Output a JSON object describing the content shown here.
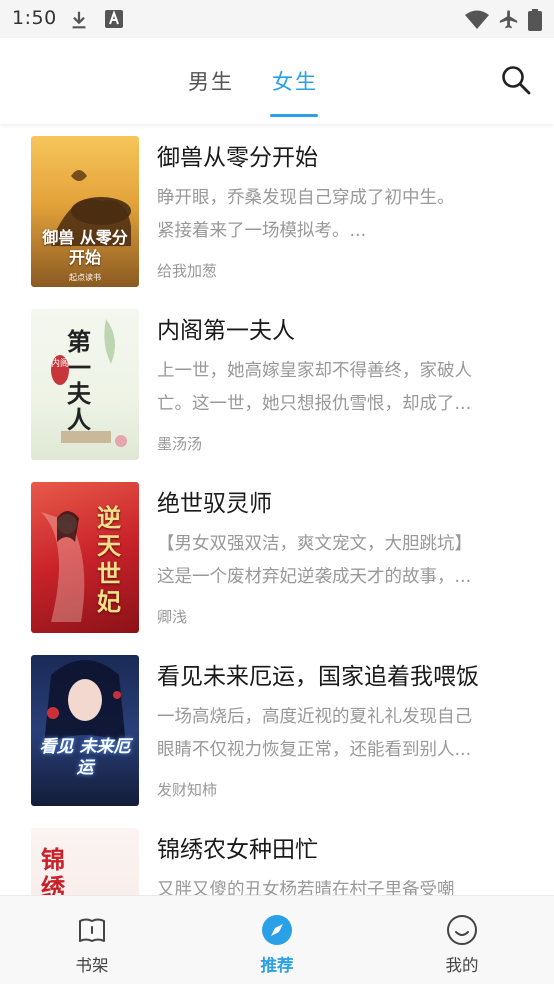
{
  "status_bar": {
    "time": "1:50",
    "icons": [
      "download-icon",
      "a-notification-icon",
      "wifi-icon",
      "airplane-icon",
      "battery-icon"
    ]
  },
  "tabs": [
    {
      "label": "男生",
      "active": false
    },
    {
      "label": "女生",
      "active": true
    }
  ],
  "colors": {
    "accent": "#2aa0e6",
    "title_text": "#1a1a1a",
    "secondary_text": "#999999"
  },
  "books": [
    {
      "title": "御兽从零分开始",
      "desc_line1": "睁开眼，乔桑发现自己穿成了初中生。",
      "desc_line2": "紧接着来了一场模拟考。...",
      "author": "给我加葱",
      "cover_text": "御兽 从零分开始",
      "cover_publisher": "起点读书"
    },
    {
      "title": "内阁第一夫人",
      "desc_line1": "上一世，她高嫁皇家却不得善终，家破人",
      "desc_line2": "亡。这一世，她只想报仇雪恨，却成了...",
      "author": "墨汤汤",
      "cover_text": "第一夫人",
      "cover_small": "内阁"
    },
    {
      "title": "绝世驭灵师",
      "desc_line1": "【男女双强双洁，爽文宠文，大胆跳坑】",
      "desc_line2": "这是一个废材弃妃逆袭成天才的故事，...",
      "author": "卿浅",
      "cover_text": "逆天世妃"
    },
    {
      "title": "看见未来厄运，国家追着我喂饭",
      "desc_line1": "一场高烧后，高度近视的夏礼礼发现自己",
      "desc_line2": "眼睛不仅视力恢复正常，还能看到别人...",
      "author": "发财知柿",
      "cover_text": "看见 未来厄运"
    },
    {
      "title": "锦绣农女种田忙",
      "desc_line1": "又胖又傻的丑女杨若晴在村子里备受嘲",
      "desc_line2": "",
      "author": "",
      "cover_text": "锦绣"
    }
  ],
  "bottom_nav": [
    {
      "label": "书架",
      "icon": "book-icon",
      "active": false
    },
    {
      "label": "推荐",
      "icon": "compass-icon",
      "active": true
    },
    {
      "label": "我的",
      "icon": "smiley-icon",
      "active": false
    }
  ]
}
